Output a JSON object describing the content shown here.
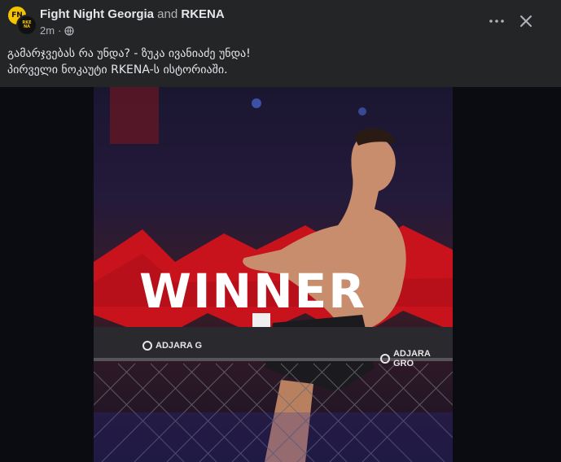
{
  "post": {
    "author_primary": "Fight Night Georgia",
    "author_connector": "and",
    "author_secondary": "RKENA",
    "time_ago": "2m",
    "visibility_icon": "globe-icon",
    "caption_line1": "გამარჯვებას რა უნდა? - ზუკა ივანიაძე უნდა!",
    "caption_line2": "პირველი ნოკაუტი RKENA-ს ისტორიაში."
  },
  "header_actions": {
    "more_icon": "more-horizontal-icon",
    "close_icon": "close-icon"
  },
  "media": {
    "banner_text": "WINNER",
    "sponsor_left": "ADJARA G",
    "sponsor_right": "ADJARA GRO",
    "banner_color": "#d0141e"
  }
}
